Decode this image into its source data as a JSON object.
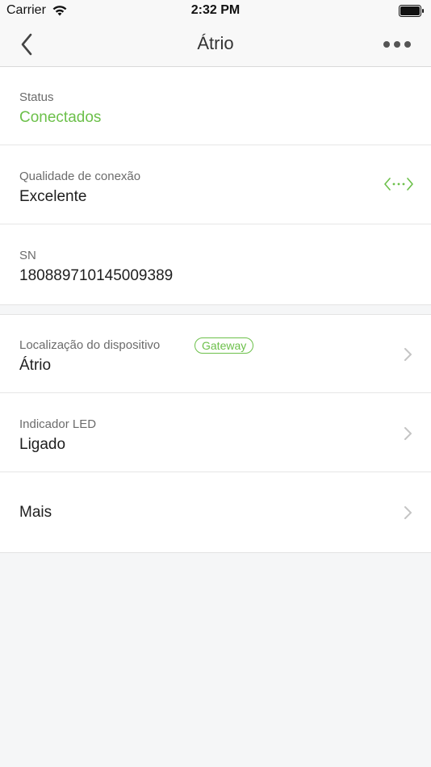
{
  "status_bar": {
    "carrier": "Carrier",
    "time": "2:32 PM",
    "icons": [
      "wifi-icon",
      "battery-icon"
    ]
  },
  "nav": {
    "title": "Átrio",
    "back_icon": "chevron-left-icon",
    "more_icon": "more-horizontal-icon"
  },
  "info": {
    "status": {
      "label": "Status",
      "value": "Conectados"
    },
    "connection": {
      "label": "Qualidade de conexão",
      "value": "Excelente",
      "icon": "signal-code-icon"
    },
    "sn": {
      "label": "SN",
      "value": "180889710145009389"
    }
  },
  "settings": {
    "location": {
      "label": "Localização do dispositivo",
      "badge": "Gateway",
      "value": "Átrio"
    },
    "led": {
      "label": "Indicador LED",
      "value": "Ligado"
    },
    "more": {
      "label": "Mais"
    }
  },
  "colors": {
    "accent": "#6cc04a",
    "background": "#f5f6f7",
    "card": "#ffffff",
    "label": "#6b6b6b",
    "chevron": "#c4c4c4"
  }
}
